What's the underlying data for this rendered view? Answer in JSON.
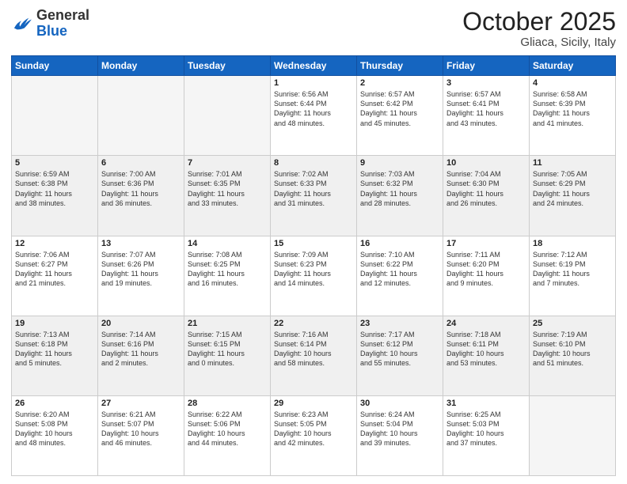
{
  "logo": {
    "general": "General",
    "blue": "Blue"
  },
  "header": {
    "month": "October 2025",
    "location": "Gliaca, Sicily, Italy"
  },
  "days_of_week": [
    "Sunday",
    "Monday",
    "Tuesday",
    "Wednesday",
    "Thursday",
    "Friday",
    "Saturday"
  ],
  "weeks": [
    [
      {
        "day": "",
        "info": "",
        "empty": true
      },
      {
        "day": "",
        "info": "",
        "empty": true
      },
      {
        "day": "",
        "info": "",
        "empty": true
      },
      {
        "day": "1",
        "info": "Sunrise: 6:56 AM\nSunset: 6:44 PM\nDaylight: 11 hours\nand 48 minutes."
      },
      {
        "day": "2",
        "info": "Sunrise: 6:57 AM\nSunset: 6:42 PM\nDaylight: 11 hours\nand 45 minutes."
      },
      {
        "day": "3",
        "info": "Sunrise: 6:57 AM\nSunset: 6:41 PM\nDaylight: 11 hours\nand 43 minutes."
      },
      {
        "day": "4",
        "info": "Sunrise: 6:58 AM\nSunset: 6:39 PM\nDaylight: 11 hours\nand 41 minutes."
      }
    ],
    [
      {
        "day": "5",
        "info": "Sunrise: 6:59 AM\nSunset: 6:38 PM\nDaylight: 11 hours\nand 38 minutes."
      },
      {
        "day": "6",
        "info": "Sunrise: 7:00 AM\nSunset: 6:36 PM\nDaylight: 11 hours\nand 36 minutes."
      },
      {
        "day": "7",
        "info": "Sunrise: 7:01 AM\nSunset: 6:35 PM\nDaylight: 11 hours\nand 33 minutes."
      },
      {
        "day": "8",
        "info": "Sunrise: 7:02 AM\nSunset: 6:33 PM\nDaylight: 11 hours\nand 31 minutes."
      },
      {
        "day": "9",
        "info": "Sunrise: 7:03 AM\nSunset: 6:32 PM\nDaylight: 11 hours\nand 28 minutes."
      },
      {
        "day": "10",
        "info": "Sunrise: 7:04 AM\nSunset: 6:30 PM\nDaylight: 11 hours\nand 26 minutes."
      },
      {
        "day": "11",
        "info": "Sunrise: 7:05 AM\nSunset: 6:29 PM\nDaylight: 11 hours\nand 24 minutes."
      }
    ],
    [
      {
        "day": "12",
        "info": "Sunrise: 7:06 AM\nSunset: 6:27 PM\nDaylight: 11 hours\nand 21 minutes."
      },
      {
        "day": "13",
        "info": "Sunrise: 7:07 AM\nSunset: 6:26 PM\nDaylight: 11 hours\nand 19 minutes."
      },
      {
        "day": "14",
        "info": "Sunrise: 7:08 AM\nSunset: 6:25 PM\nDaylight: 11 hours\nand 16 minutes."
      },
      {
        "day": "15",
        "info": "Sunrise: 7:09 AM\nSunset: 6:23 PM\nDaylight: 11 hours\nand 14 minutes."
      },
      {
        "day": "16",
        "info": "Sunrise: 7:10 AM\nSunset: 6:22 PM\nDaylight: 11 hours\nand 12 minutes."
      },
      {
        "day": "17",
        "info": "Sunrise: 7:11 AM\nSunset: 6:20 PM\nDaylight: 11 hours\nand 9 minutes."
      },
      {
        "day": "18",
        "info": "Sunrise: 7:12 AM\nSunset: 6:19 PM\nDaylight: 11 hours\nand 7 minutes."
      }
    ],
    [
      {
        "day": "19",
        "info": "Sunrise: 7:13 AM\nSunset: 6:18 PM\nDaylight: 11 hours\nand 5 minutes."
      },
      {
        "day": "20",
        "info": "Sunrise: 7:14 AM\nSunset: 6:16 PM\nDaylight: 11 hours\nand 2 minutes."
      },
      {
        "day": "21",
        "info": "Sunrise: 7:15 AM\nSunset: 6:15 PM\nDaylight: 11 hours\nand 0 minutes."
      },
      {
        "day": "22",
        "info": "Sunrise: 7:16 AM\nSunset: 6:14 PM\nDaylight: 10 hours\nand 58 minutes."
      },
      {
        "day": "23",
        "info": "Sunrise: 7:17 AM\nSunset: 6:12 PM\nDaylight: 10 hours\nand 55 minutes."
      },
      {
        "day": "24",
        "info": "Sunrise: 7:18 AM\nSunset: 6:11 PM\nDaylight: 10 hours\nand 53 minutes."
      },
      {
        "day": "25",
        "info": "Sunrise: 7:19 AM\nSunset: 6:10 PM\nDaylight: 10 hours\nand 51 minutes."
      }
    ],
    [
      {
        "day": "26",
        "info": "Sunrise: 6:20 AM\nSunset: 5:08 PM\nDaylight: 10 hours\nand 48 minutes."
      },
      {
        "day": "27",
        "info": "Sunrise: 6:21 AM\nSunset: 5:07 PM\nDaylight: 10 hours\nand 46 minutes."
      },
      {
        "day": "28",
        "info": "Sunrise: 6:22 AM\nSunset: 5:06 PM\nDaylight: 10 hours\nand 44 minutes."
      },
      {
        "day": "29",
        "info": "Sunrise: 6:23 AM\nSunset: 5:05 PM\nDaylight: 10 hours\nand 42 minutes."
      },
      {
        "day": "30",
        "info": "Sunrise: 6:24 AM\nSunset: 5:04 PM\nDaylight: 10 hours\nand 39 minutes."
      },
      {
        "day": "31",
        "info": "Sunrise: 6:25 AM\nSunset: 5:03 PM\nDaylight: 10 hours\nand 37 minutes."
      },
      {
        "day": "",
        "info": "",
        "empty": true
      }
    ]
  ]
}
